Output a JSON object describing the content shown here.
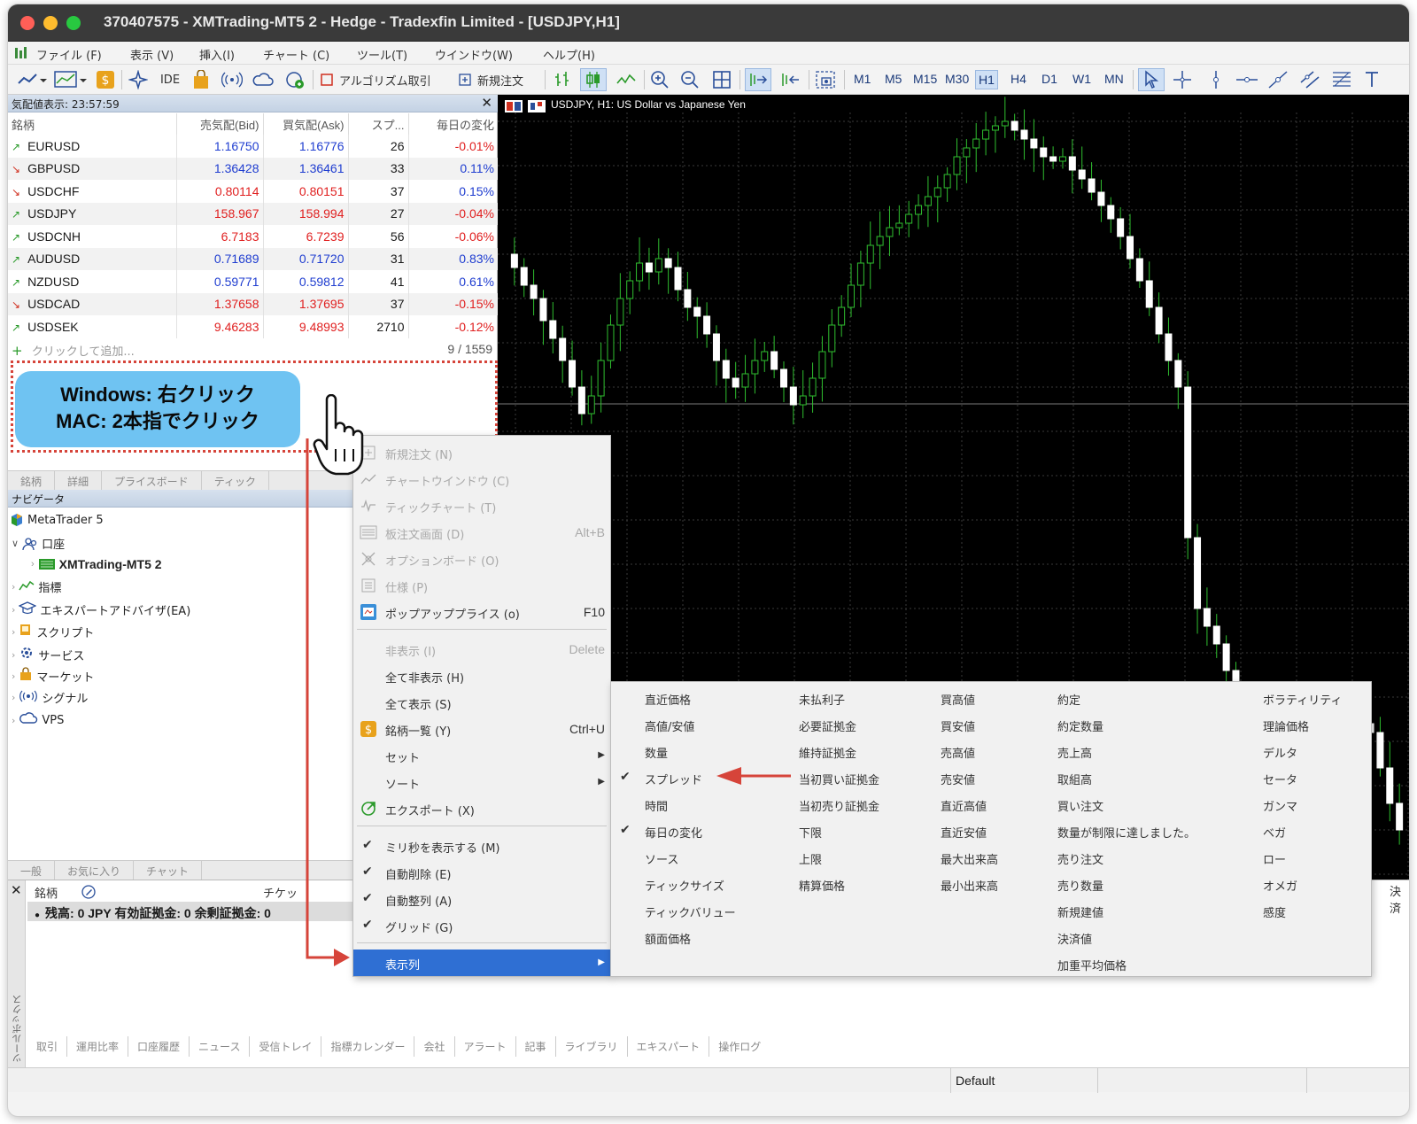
{
  "window": {
    "title": "370407575 - XMTrading-MT5 2 - Hedge - Tradexfin Limited - [USDJPY,H1]"
  },
  "menubar": {
    "items": [
      "ファイル (F)",
      "表示 (V)",
      "挿入(I)",
      "チャート (C)",
      "ツール(T)",
      "ウインドウ(W)",
      "ヘルプ(H)"
    ]
  },
  "toolbar": {
    "ide_label": "IDE",
    "algo_label": "アルゴリズム取引",
    "new_order_label": "新規注文",
    "timeframes": [
      "M1",
      "M5",
      "M15",
      "M30",
      "H1",
      "H4",
      "D1",
      "W1",
      "MN"
    ],
    "active_timeframe": "H1"
  },
  "market_watch": {
    "header": "気配値表示: 23:57:59",
    "columns": [
      "銘柄",
      "売気配(Bid)",
      "買気配(Ask)",
      "スプ...",
      "毎日の変化"
    ],
    "rows": [
      {
        "symbol": "EURUSD",
        "dir": "up",
        "bid": "1.16750",
        "ask": "1.16776",
        "spread": "26",
        "change": "-0.01%",
        "bid_color": "blue",
        "ask_color": "blue",
        "change_color": "red"
      },
      {
        "symbol": "GBPUSD",
        "dir": "down",
        "bid": "1.36428",
        "ask": "1.36461",
        "spread": "33",
        "change": "0.11%",
        "bid_color": "blue",
        "ask_color": "blue",
        "change_color": "blue"
      },
      {
        "symbol": "USDCHF",
        "dir": "down",
        "bid": "0.80114",
        "ask": "0.80151",
        "spread": "37",
        "change": "0.15%",
        "bid_color": "red",
        "ask_color": "red",
        "change_color": "blue"
      },
      {
        "symbol": "USDJPY",
        "dir": "up",
        "bid": "158.967",
        "ask": "158.994",
        "spread": "27",
        "change": "-0.04%",
        "bid_color": "red",
        "ask_color": "red",
        "change_color": "red"
      },
      {
        "symbol": "USDCNH",
        "dir": "up",
        "bid": "6.7183",
        "ask": "6.7239",
        "spread": "56",
        "change": "-0.06%",
        "bid_color": "red",
        "ask_color": "red",
        "change_color": "red"
      },
      {
        "symbol": "AUDUSD",
        "dir": "up",
        "bid": "0.71689",
        "ask": "0.71720",
        "spread": "31",
        "change": "0.83%",
        "bid_color": "blue",
        "ask_color": "blue",
        "change_color": "blue"
      },
      {
        "symbol": "NZDUSD",
        "dir": "up",
        "bid": "0.59771",
        "ask": "0.59812",
        "spread": "41",
        "change": "0.61%",
        "bid_color": "blue",
        "ask_color": "blue",
        "change_color": "blue"
      },
      {
        "symbol": "USDCAD",
        "dir": "down",
        "bid": "1.37658",
        "ask": "1.37695",
        "spread": "37",
        "change": "-0.15%",
        "bid_color": "red",
        "ask_color": "red",
        "change_color": "red"
      },
      {
        "symbol": "USDSEK",
        "dir": "up",
        "bid": "9.46283",
        "ask": "9.48993",
        "spread": "2710",
        "change": "-0.12%",
        "bid_color": "red",
        "ask_color": "red",
        "change_color": "red"
      }
    ],
    "add_label": "クリックして追加...",
    "count": "9 / 1559",
    "tabs": [
      "銘柄",
      "詳細",
      "プライスボード",
      "ティック"
    ]
  },
  "annotation": {
    "line1": "Windows: 右クリック",
    "line2": "MAC: 2本指でクリック"
  },
  "navigator": {
    "header": "ナビゲータ",
    "root": "MetaTrader 5",
    "accounts": "口座",
    "account_server": "XMTrading-MT5 2",
    "items": [
      "指標",
      "エキスパートアドバイザ(EA)",
      "スクリプト",
      "サービス",
      "マーケット",
      "シグナル",
      "VPS"
    ],
    "tabs": [
      "一般",
      "お気に入り",
      "チャット"
    ]
  },
  "chart": {
    "title": "USDJPY, H1:  US Dollar vs Japanese Yen"
  },
  "toolbox": {
    "col_symbol": "銘柄",
    "col_ticket": "チケッ",
    "col_right": "決済",
    "balance": "残高: 0 JPY  有効証拠金: 0  余剰証拠金: 0",
    "vertical_label": "ツールボックス",
    "tabs": [
      "取引",
      "運用比率",
      "口座履歴",
      "ニュース",
      "受信トレイ",
      "指標カレンダー",
      "会社",
      "アラート",
      "記事",
      "ライブラリ",
      "エキスパート",
      "操作ログ"
    ]
  },
  "statusbar": {
    "profile": "Default"
  },
  "context_menu": {
    "items": [
      {
        "label": "新規注文 (N)",
        "disabled": true,
        "icon": "new-order-icon"
      },
      {
        "label": "チャートウインドウ (C)",
        "disabled": true,
        "icon": "chart-window-icon"
      },
      {
        "label": "ティックチャート (T)",
        "disabled": true,
        "icon": "tick-chart-icon"
      },
      {
        "label": "板注文画面 (D)",
        "disabled": true,
        "shortcut": "Alt+B",
        "icon": "depth-icon"
      },
      {
        "label": "オプションボード (O)",
        "disabled": true,
        "icon": "option-board-icon"
      },
      {
        "label": "仕様 (P)",
        "disabled": true,
        "icon": "spec-icon"
      },
      {
        "label": "ポップアッププライス (o)",
        "disabled": false,
        "shortcut": "F10",
        "icon": "popup-price-icon"
      },
      {
        "label": "非表示 (I)",
        "disabled": true,
        "shortcut": "Delete"
      },
      {
        "label": "全て非表示 (H)",
        "disabled": false
      },
      {
        "label": "全て表示 (S)",
        "disabled": false
      },
      {
        "label": "銘柄一覧 (Y)",
        "disabled": false,
        "shortcut": "Ctrl+U",
        "icon": "symbols-icon"
      },
      {
        "label": "セット",
        "disabled": false,
        "submenu": true
      },
      {
        "label": "ソート",
        "disabled": false,
        "submenu": true
      },
      {
        "label": "エクスポート (X)",
        "disabled": false,
        "icon": "export-icon"
      },
      {
        "label": "ミリ秒を表示する (M)",
        "checked": true
      },
      {
        "label": "自動削除 (E)",
        "checked": true
      },
      {
        "label": "自動整列 (A)",
        "checked": true
      },
      {
        "label": "グリッド (G)",
        "checked": true
      },
      {
        "label": "表示列",
        "highlighted": true,
        "submenu": true
      }
    ]
  },
  "columns_submenu": {
    "col1": [
      {
        "label": "直近価格"
      },
      {
        "label": "高値/安値"
      },
      {
        "label": "数量"
      },
      {
        "label": "スプレッド",
        "checked": true
      },
      {
        "label": "時間"
      },
      {
        "label": "毎日の変化",
        "checked": true
      },
      {
        "label": "ソース"
      },
      {
        "label": "ティックサイズ"
      },
      {
        "label": "ティックバリュー"
      },
      {
        "label": "額面価格"
      }
    ],
    "col2": [
      "未払利子",
      "必要証拠金",
      "維持証拠金",
      "当初買い証拠金",
      "当初売り証拠金",
      "下限",
      "上限",
      "精算価格"
    ],
    "col3": [
      "買高値",
      "買安値",
      "売高値",
      "売安値",
      "直近高値",
      "直近安値",
      "最大出来高",
      "最小出来高"
    ],
    "col4": [
      "約定",
      "約定数量",
      "売上高",
      "取組高",
      "買い注文",
      "数量が制限に達しました。",
      "売り注文",
      "売り数量",
      "新規建値",
      "決済値",
      "加重平均価格"
    ],
    "col5": [
      "ボラティリティ",
      "理論価格",
      "デルタ",
      "セータ",
      "ガンマ",
      "ベガ",
      "ロー",
      "オメガ",
      "感度"
    ]
  }
}
